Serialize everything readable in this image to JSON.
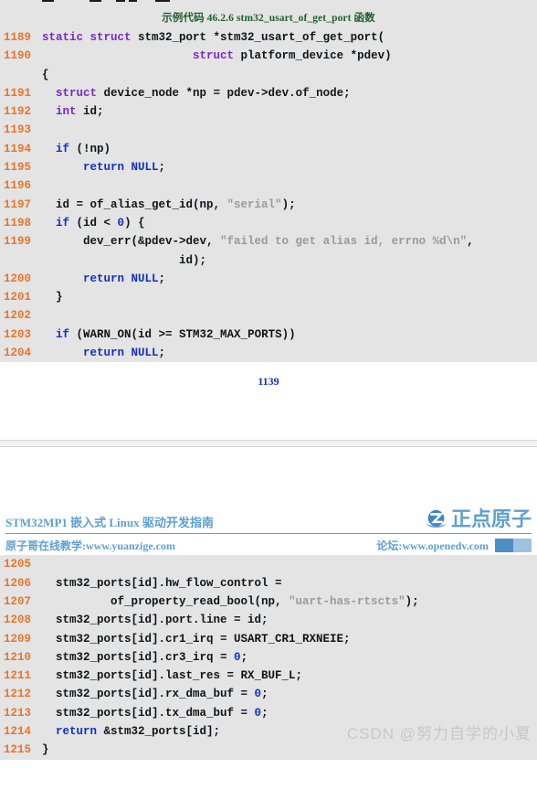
{
  "document": {
    "title_zh": "STM32MP1 嵌入式 Linux 驱动开发指南",
    "subtitle_left": "原子哥在线教学:www.yuanzige.com",
    "subtitle_right": "论坛:www.openedv.com",
    "brand_name": "正点原子",
    "brand_color": "#5e9fd4",
    "page_number": "1139",
    "watermark": "CSDN @努力自学的小夏"
  },
  "listing": {
    "caption": "示例代码 46.2.6 stm32_usart_of_get_port 函数",
    "caption_color": "#1f6030",
    "background": "#e4e4e4",
    "line_number_color": "#e8762b",
    "keyword_color": "#7a28c7",
    "control_keyword_color": "#1330c4",
    "string_color": "#9a9a9a",
    "block_a": [
      {
        "n": "1189",
        "segments": [
          {
            "t": "kw",
            "s": "static struct"
          },
          {
            "t": "pl",
            "s": " stm32_port *stm32_usart_of_get_port("
          }
        ]
      },
      {
        "n": "1190",
        "segments": [
          {
            "t": "pl",
            "s": "                      "
          },
          {
            "t": "kw",
            "s": "struct"
          },
          {
            "t": "pl",
            "s": " platform_device *pdev)"
          }
        ]
      },
      {
        "n": "1190b",
        "segments": [
          {
            "t": "pl",
            "s": "{"
          }
        ]
      },
      {
        "n": "1191",
        "segments": [
          {
            "t": "pl",
            "s": "  "
          },
          {
            "t": "kw",
            "s": "struct"
          },
          {
            "t": "pl",
            "s": " device_node *np = pdev->dev.of_node;"
          }
        ]
      },
      {
        "n": "1192",
        "segments": [
          {
            "t": "pl",
            "s": "  "
          },
          {
            "t": "kw",
            "s": "int"
          },
          {
            "t": "pl",
            "s": " id;"
          }
        ]
      },
      {
        "n": "1193",
        "segments": [
          {
            "t": "pl",
            "s": ""
          }
        ]
      },
      {
        "n": "1194",
        "segments": [
          {
            "t": "pl",
            "s": "  "
          },
          {
            "t": "kw2",
            "s": "if"
          },
          {
            "t": "pl",
            "s": " (!np)"
          }
        ]
      },
      {
        "n": "1195",
        "segments": [
          {
            "t": "pl",
            "s": "      "
          },
          {
            "t": "kw2",
            "s": "return NULL"
          },
          {
            "t": "pl",
            "s": ";"
          }
        ]
      },
      {
        "n": "1196",
        "segments": [
          {
            "t": "pl",
            "s": ""
          }
        ]
      },
      {
        "n": "1197",
        "segments": [
          {
            "t": "pl",
            "s": "  id = of_alias_get_id(np, "
          },
          {
            "t": "str",
            "s": "\"serial\""
          },
          {
            "t": "pl",
            "s": ");"
          }
        ]
      },
      {
        "n": "1198",
        "segments": [
          {
            "t": "pl",
            "s": "  "
          },
          {
            "t": "kw2",
            "s": "if"
          },
          {
            "t": "pl",
            "s": " (id < "
          },
          {
            "t": "num",
            "s": "0"
          },
          {
            "t": "pl",
            "s": ") {"
          }
        ]
      },
      {
        "n": "1199",
        "segments": [
          {
            "t": "pl",
            "s": "      dev_err(&pdev->dev, "
          },
          {
            "t": "str",
            "s": "\"failed to get alias id, errno %d\\n\""
          },
          {
            "t": "pl",
            "s": ","
          }
        ]
      },
      {
        "n": "1199b",
        "segments": [
          {
            "t": "pl",
            "s": "                    id);"
          }
        ]
      },
      {
        "n": "1200",
        "segments": [
          {
            "t": "pl",
            "s": "      "
          },
          {
            "t": "kw2",
            "s": "return NULL"
          },
          {
            "t": "pl",
            "s": ";"
          }
        ]
      },
      {
        "n": "1201",
        "segments": [
          {
            "t": "pl",
            "s": "  }"
          }
        ]
      },
      {
        "n": "1202",
        "segments": [
          {
            "t": "pl",
            "s": ""
          }
        ]
      },
      {
        "n": "1203",
        "segments": [
          {
            "t": "pl",
            "s": "  "
          },
          {
            "t": "kw2",
            "s": "if"
          },
          {
            "t": "pl",
            "s": " (WARN_ON(id >= STM32_MAX_PORTS))"
          }
        ]
      },
      {
        "n": "1204",
        "segments": [
          {
            "t": "pl",
            "s": "      "
          },
          {
            "t": "kw2",
            "s": "return NULL"
          },
          {
            "t": "pl",
            "s": ";"
          }
        ]
      }
    ],
    "block_b": [
      {
        "n": "1205",
        "segments": [
          {
            "t": "pl",
            "s": ""
          }
        ]
      },
      {
        "n": "1206",
        "segments": [
          {
            "t": "pl",
            "s": "  stm32_ports[id].hw_flow_control ="
          }
        ]
      },
      {
        "n": "1207",
        "segments": [
          {
            "t": "pl",
            "s": "          of_property_read_bool(np, "
          },
          {
            "t": "str",
            "s": "\"uart-has-rtscts\""
          },
          {
            "t": "pl",
            "s": ");"
          }
        ]
      },
      {
        "n": "1208",
        "segments": [
          {
            "t": "pl",
            "s": "  stm32_ports[id].port.line = id;"
          }
        ]
      },
      {
        "n": "1209",
        "segments": [
          {
            "t": "pl",
            "s": "  stm32_ports[id].cr1_irq = USART_CR1_RXNEIE;"
          }
        ]
      },
      {
        "n": "1210",
        "segments": [
          {
            "t": "pl",
            "s": "  stm32_ports[id].cr3_irq = "
          },
          {
            "t": "num",
            "s": "0"
          },
          {
            "t": "pl",
            "s": ";"
          }
        ]
      },
      {
        "n": "1211",
        "segments": [
          {
            "t": "pl",
            "s": "  stm32_ports[id].last_res = RX_BUF_L;"
          }
        ]
      },
      {
        "n": "1212",
        "segments": [
          {
            "t": "pl",
            "s": "  stm32_ports[id].rx_dma_buf = "
          },
          {
            "t": "num",
            "s": "0"
          },
          {
            "t": "pl",
            "s": ";"
          }
        ]
      },
      {
        "n": "1213",
        "segments": [
          {
            "t": "pl",
            "s": "  stm32_ports[id].tx_dma_buf = "
          },
          {
            "t": "num",
            "s": "0"
          },
          {
            "t": "pl",
            "s": ";"
          }
        ]
      },
      {
        "n": "1214",
        "segments": [
          {
            "t": "pl",
            "s": "  "
          },
          {
            "t": "kw2",
            "s": "return"
          },
          {
            "t": "pl",
            "s": " &stm32_ports[id];"
          }
        ]
      },
      {
        "n": "1215",
        "segments": [
          {
            "t": "pl",
            "s": "}"
          }
        ]
      }
    ]
  }
}
